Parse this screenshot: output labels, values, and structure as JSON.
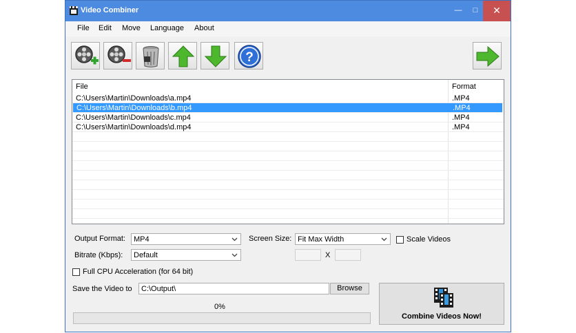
{
  "window": {
    "title": "Video Combiner",
    "minimize": "—",
    "maximize": "□",
    "close": "✕"
  },
  "menu": [
    "File",
    "Edit",
    "Move",
    "Language",
    "About"
  ],
  "toolbar": {
    "buttons": [
      {
        "name": "add-video-button",
        "icon": "film-reel-plus-icon"
      },
      {
        "name": "remove-video-button",
        "icon": "film-reel-minus-icon"
      },
      {
        "name": "clear-list-button",
        "icon": "trash-bin-icon"
      },
      {
        "name": "move-up-button",
        "icon": "arrow-up-icon"
      },
      {
        "name": "move-down-button",
        "icon": "arrow-down-icon"
      },
      {
        "name": "help-button",
        "icon": "help-icon"
      }
    ],
    "next_icon": "arrow-right-icon"
  },
  "file_list": {
    "columns": {
      "file": "File",
      "format": "Format"
    },
    "rows": [
      {
        "file": "C:\\Users\\Martin\\Downloads\\a.mp4",
        "format": ".MP4",
        "selected": false
      },
      {
        "file": "C:\\Users\\Martin\\Downloads\\b.mp4",
        "format": ".MP4",
        "selected": true
      },
      {
        "file": "C:\\Users\\Martin\\Downloads\\c.mp4",
        "format": ".MP4",
        "selected": false
      },
      {
        "file": "C:\\Users\\Martin\\Downloads\\d.mp4",
        "format": ".MP4",
        "selected": false
      }
    ]
  },
  "settings": {
    "output_format_label": "Output Format:",
    "output_format_value": "MP4",
    "screen_size_label": "Screen Size:",
    "screen_size_value": "Fit Max Width",
    "scale_videos_label": "Scale Videos",
    "scale_videos_checked": false,
    "bitrate_label": "Bitrate (Kbps):",
    "bitrate_value": "Default",
    "size_separator": "X",
    "width_value": "",
    "height_value": "",
    "full_cpu_label": "Full CPU Acceleration (for 64 bit)",
    "full_cpu_checked": false,
    "save_label": "Save the Video to",
    "save_path": "C:\\Output\\",
    "browse_label": "Browse"
  },
  "progress": {
    "text": "0%",
    "value": 0
  },
  "combine_button_label": "Combine Videos Now!",
  "colors": {
    "titlebar": "#4d8be0",
    "selection": "#3399ff",
    "close": "#c75050",
    "arrow_green": "#4db82d",
    "help_blue": "#2f6fd8"
  }
}
